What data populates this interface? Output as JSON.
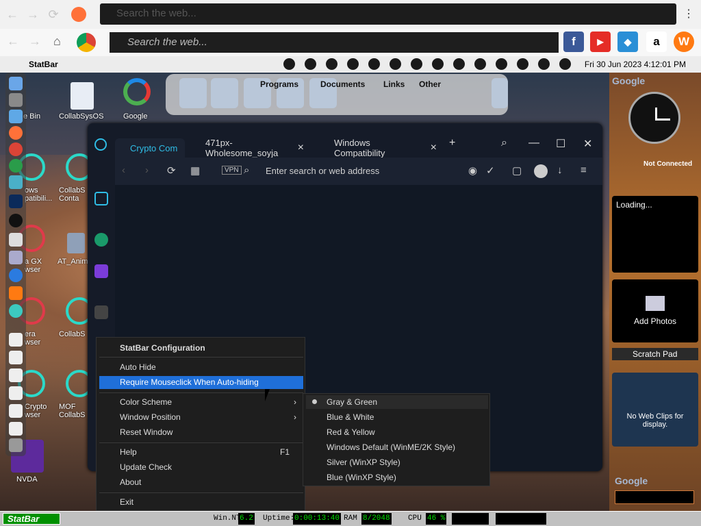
{
  "toolbar_top": {
    "search_placeholder": "Search the web..."
  },
  "toolbar_second": {
    "search_placeholder": "Search the web...",
    "quick_links": [
      {
        "name": "facebook-icon",
        "glyph": "f",
        "color": "#3b5998"
      },
      {
        "name": "youtube-icon",
        "glyph": "▶",
        "color": "#e52d27"
      },
      {
        "name": "games-icon",
        "glyph": "◆",
        "color": "#2a8fd6"
      },
      {
        "name": "amazon-icon",
        "glyph": "a",
        "color": "#ffffff"
      },
      {
        "name": "w-icon",
        "glyph": "W",
        "color": "#ff7a12"
      }
    ]
  },
  "menubar": {
    "app_name": "StatBar",
    "clock": "Fri 30 Jun 2023  4:12:01 PM"
  },
  "launcher": {
    "links": [
      "Programs",
      "Documents",
      "Links",
      "Other"
    ]
  },
  "desktop_icons": [
    {
      "label": "e Bin"
    },
    {
      "label": "CollabSysOS"
    },
    {
      "label": "Google"
    },
    {
      "label": "ows\npatibili..."
    },
    {
      "label": "CollabS\nConta"
    },
    {
      "label": "a GX\nwser"
    },
    {
      "label": "AT_Anim"
    },
    {
      "label": "era\nwser"
    },
    {
      "label": "CollabS"
    },
    {
      "label": "Crypto\nwser"
    },
    {
      "label": "MOF\nCollabS"
    },
    {
      "label": "NVDA"
    }
  ],
  "widgets": {
    "google_label": "Google",
    "status": "Not Connected",
    "loading": "Loading...",
    "add_photos": "Add Photos",
    "scratch_pad": "Scratch Pad",
    "web_clips": "No Web Clips for display.",
    "google_bottom": "Google"
  },
  "browser": {
    "tabs": [
      {
        "label": "Crypto Com",
        "active": true
      },
      {
        "label": "471px-Wholesome_soyja",
        "active": false
      },
      {
        "label": "Windows Compatibility",
        "active": false
      }
    ],
    "address_placeholder": "Enter search or web address",
    "vpn_label": "VPN"
  },
  "context_menu": {
    "title": "StatBar Configuration",
    "items": [
      {
        "label": "Auto Hide"
      },
      {
        "label": "Require Mouseclick When Auto-hiding",
        "selected": true
      },
      {
        "label": "Color Scheme",
        "submenu": true
      },
      {
        "label": "Window Position",
        "submenu": true
      },
      {
        "label": "Reset Window"
      },
      {
        "label": "Help",
        "shortcut": "F1"
      },
      {
        "label": "Update Check"
      },
      {
        "label": "About"
      },
      {
        "label": "Exit"
      }
    ]
  },
  "color_scheme_menu": [
    {
      "label": "Gray & Green",
      "checked": true
    },
    {
      "label": "Blue & White"
    },
    {
      "label": "Red & Yellow"
    },
    {
      "label": "Windows Default (WinME/2K Style)"
    },
    {
      "label": "Silver (WinXP Style)"
    },
    {
      "label": "Blue (WinXP Style)"
    }
  ],
  "statbar": {
    "start_label": "StatBar",
    "os_label": "Win.NT",
    "os_value": "6.2",
    "uptime_label": "Uptime:",
    "uptime_value": "0:00:13:40",
    "ram_label": "RAM",
    "ram_value": "8/2048",
    "cpu_label": "CPU",
    "cpu_value": "46 %"
  }
}
